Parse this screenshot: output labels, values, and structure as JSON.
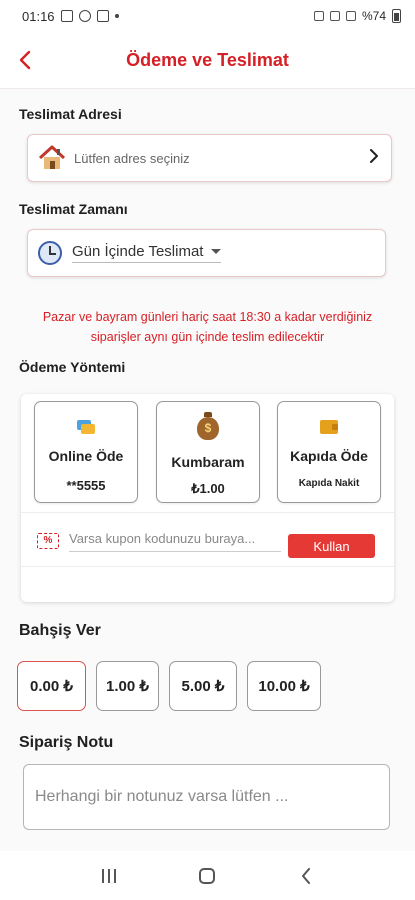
{
  "status_bar": {
    "time": "01:16",
    "battery": "%74"
  },
  "header": {
    "title": "Ödeme ve Teslimat",
    "accent_color": "#d62027"
  },
  "delivery_address": {
    "label": "Teslimat Adresi",
    "placeholder": "Lütfen adres seçiniz",
    "icon": "house-icon"
  },
  "delivery_time": {
    "label": "Teslimat Zamanı",
    "selected": "Gün İçinde Teslimat",
    "icon": "clock-icon"
  },
  "notice": "Pazar ve bayram günleri hariç saat 18:30 a kadar verdiğiniz siparişler aynı gün içinde teslim edilecektir",
  "payment": {
    "label": "Ödeme Yöntemi",
    "options": [
      {
        "title": "Online Öde",
        "subtitle": "**5555",
        "icon": "credit-card-icon"
      },
      {
        "title": "Kumbaram",
        "subtitle": "₺1.00",
        "icon": "money-bag-icon"
      },
      {
        "title": "Kapıda Öde",
        "subtitle": "Kapıda Nakit",
        "icon": "wallet-icon"
      }
    ],
    "coupon": {
      "placeholder": "Varsa kupon kodunuzu buraya...",
      "button_label": "Kullan",
      "icon": "coupon-icon"
    }
  },
  "tip": {
    "label": "Bahşiş Ver",
    "options": [
      "0.00 ₺",
      "1.00 ₺",
      "5.00 ₺",
      "10.00 ₺"
    ],
    "selected_index": 0
  },
  "order_note": {
    "label": "Sipariş Notu",
    "placeholder": "Herhangi bir notunuz varsa lütfen ..."
  }
}
